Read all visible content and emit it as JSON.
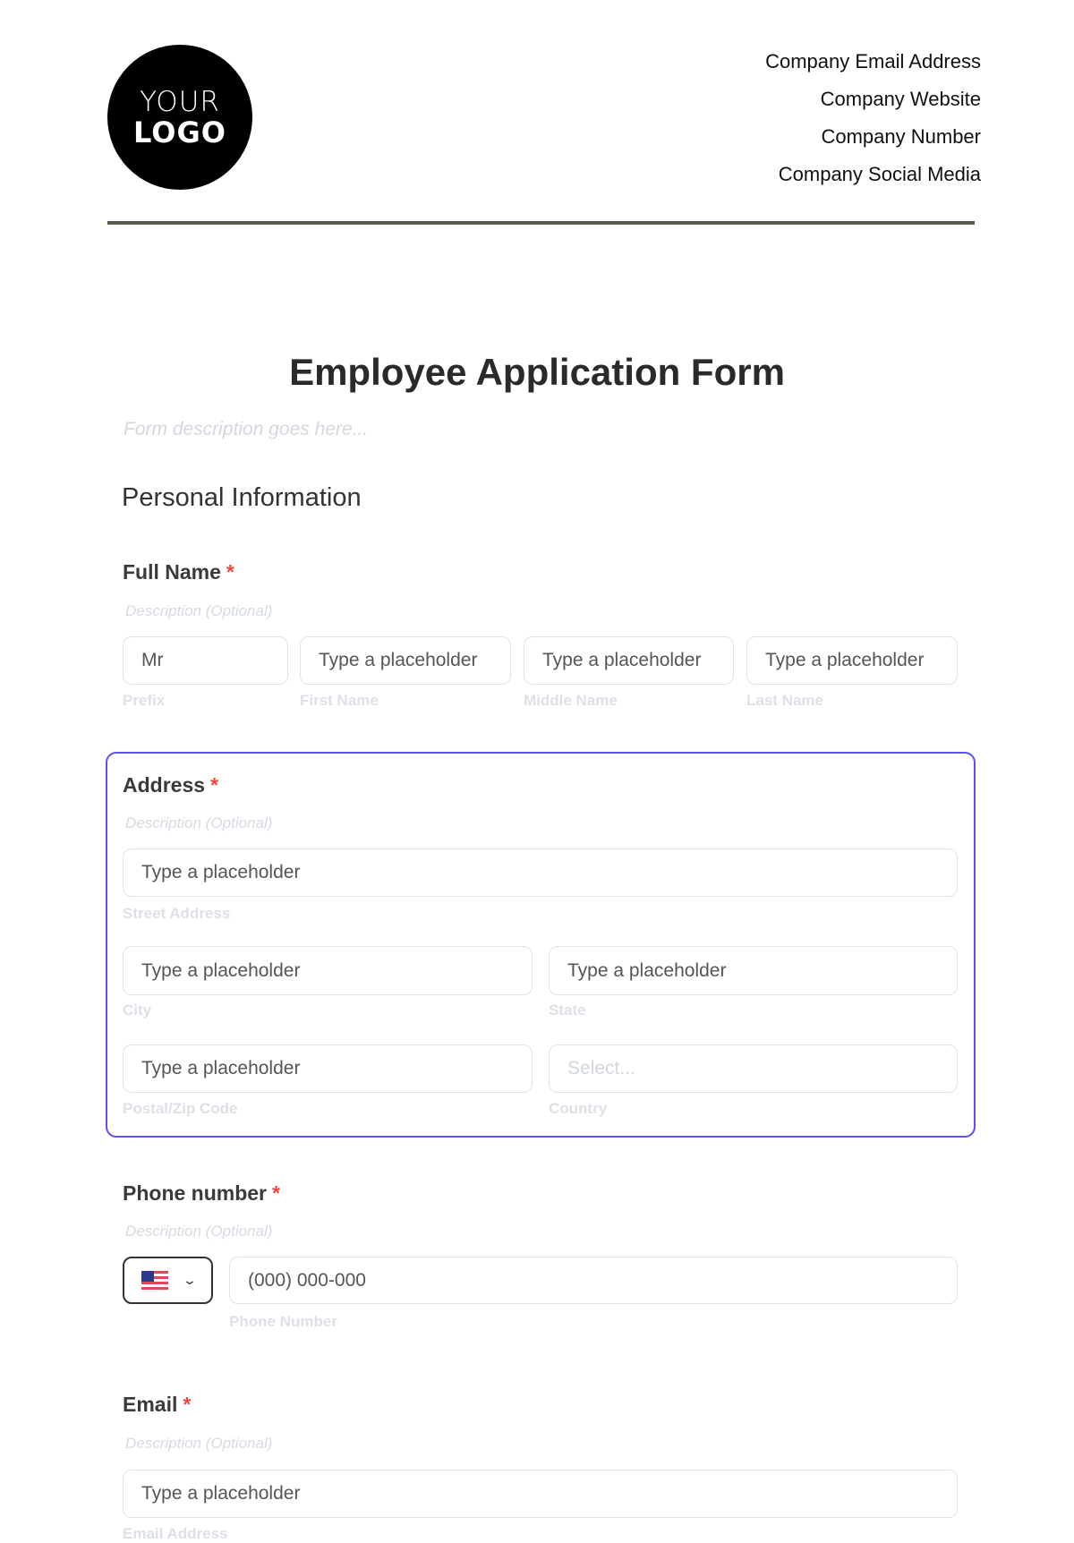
{
  "header": {
    "logo": {
      "line1": "YOUR",
      "line2": "LOGO"
    },
    "company_info": [
      "Company Email Address",
      "Company Website",
      "Company Number",
      "Company Social Media"
    ]
  },
  "form": {
    "title": "Employee Application Form",
    "description": "Form description goes here...",
    "section_title": "Personal Information",
    "required_marker": "*",
    "fields": {
      "full_name": {
        "label": "Full Name",
        "description": "Description (Optional)",
        "inputs": [
          {
            "value": "Mr",
            "sublabel": "Prefix"
          },
          {
            "placeholder": "Type a placeholder",
            "sublabel": "First Name"
          },
          {
            "placeholder": "Type a placeholder",
            "sublabel": "Middle Name"
          },
          {
            "placeholder": "Type a placeholder",
            "sublabel": "Last Name"
          }
        ]
      },
      "address": {
        "label": "Address",
        "description": "Description (Optional)",
        "street": {
          "placeholder": "Type a placeholder",
          "sublabel": "Street Address"
        },
        "city": {
          "placeholder": "Type a placeholder",
          "sublabel": "City"
        },
        "state": {
          "placeholder": "Type a placeholder",
          "sublabel": "State"
        },
        "postal": {
          "placeholder": "Type a placeholder",
          "sublabel": "Postal/Zip Code"
        },
        "country": {
          "placeholder": "Select...",
          "sublabel": "Country"
        }
      },
      "phone": {
        "label": "Phone number",
        "description": "Description (Optional)",
        "country_flag": "us-flag-icon",
        "placeholder": "(000) 000-000",
        "sublabel": "Phone Number"
      },
      "email": {
        "label": "Email",
        "description": "Description (Optional)",
        "placeholder": "Type a placeholder",
        "sublabel": "Email Address"
      }
    }
  },
  "colors": {
    "focus_border": "#5b4ff5",
    "required": "#f2473b",
    "divider": "#5a5a4c"
  }
}
